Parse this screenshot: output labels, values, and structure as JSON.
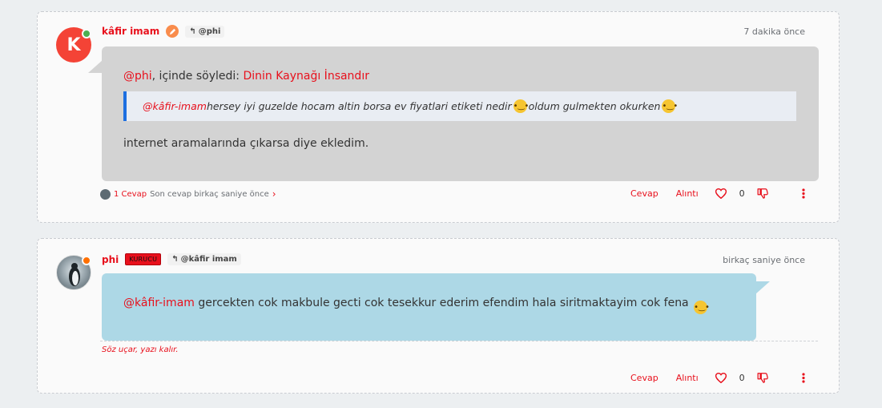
{
  "colors": {
    "accent": "#e8101c",
    "page_bg": "#eceff1",
    "bubble_grey": "#d3d3d3",
    "bubble_blue": "#add8e6",
    "online": "#4caf50",
    "away": "#ff6f00",
    "quote_border": "#1d6fe0"
  },
  "posts": [
    {
      "avatar_letter": "K",
      "status": "online",
      "username": "kâfir imam",
      "edit_icon": "pencil-icon",
      "reply_to": "@phi",
      "timestamp": "7 dakika önce",
      "content": {
        "mention": "@phi",
        "said_in": ", içinde söyledi: ",
        "topic_link": "Dinin Kaynağı İnsandır",
        "quote_mention": "@kâfir-imam",
        "quote_text_1": " hersey iyi guzelde hocam altin borsa ev fiyatlari etiketi nedir ",
        "quote_text_2": " oldum gulmekten okurken ",
        "body": "internet aramalarında çıkarsa diye ekledim."
      },
      "reply_info": {
        "count_label": "1 Cevap",
        "last_label": "Son cevap birkaç saniye önce"
      },
      "actions": {
        "reply": "Cevap",
        "quote": "Alıntı",
        "votes": "0"
      }
    },
    {
      "status": "away",
      "username": "phi",
      "role_badge": "KURUCU",
      "reply_to": "@kâfir imam",
      "timestamp": "birkaç saniye önce",
      "content": {
        "mention": "@kâfir-imam",
        "text": " gercekten cok makbule gecti cok tesekkur ederim efendim hala siritmaktayim cok fena "
      },
      "signature": "Söz uçar, yazı kalır.",
      "actions": {
        "reply": "Cevap",
        "quote": "Alıntı",
        "votes": "0"
      }
    }
  ]
}
